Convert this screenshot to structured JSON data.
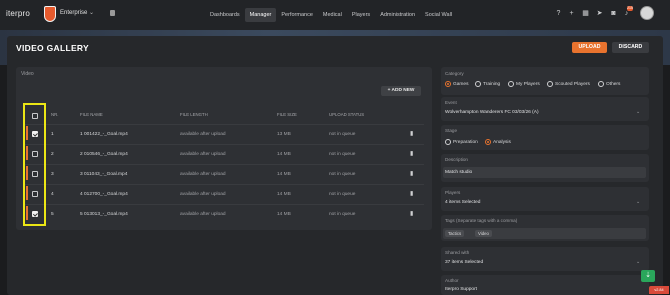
{
  "app": {
    "logo": "iterpro",
    "org": "Enterprise"
  },
  "nav": [
    "Dashboards",
    "Manager",
    "Performance",
    "Medical",
    "Players",
    "Administration",
    "Social Wall"
  ],
  "nav_active": "Manager",
  "notifications": "215",
  "page": {
    "title": "VIDEO GALLERY",
    "upload": "UPLOAD",
    "discard": "DISCARD"
  },
  "video": {
    "label": "Video",
    "add": "+ ADD NEW",
    "columns": [
      "NR.",
      "FILE NAME",
      "FILE LENGTH",
      "FILE SIZE",
      "UPLOAD STATUS"
    ],
    "rows": [
      {
        "nr": "1",
        "name": "1 001422_-_Goal.mp4",
        "length": "available after upload",
        "size": "13 MB",
        "status": "not in queue"
      },
      {
        "nr": "2",
        "name": "2 010546_-_Goal.mp4",
        "length": "available after upload",
        "size": "14 MB",
        "status": "not in queue"
      },
      {
        "nr": "3",
        "name": "3 011043_-_Goal.mp4",
        "length": "available after upload",
        "size": "14 MB",
        "status": "not in queue"
      },
      {
        "nr": "4",
        "name": "4 012700_-_Goal.mp4",
        "length": "available after upload",
        "size": "14 MB",
        "status": "not in queue"
      },
      {
        "nr": "5",
        "name": "5 013013_-_Goal.mp4",
        "length": "available after upload",
        "size": "14 MB",
        "status": "not in queue"
      }
    ]
  },
  "form": {
    "category_label": "Category",
    "categories": [
      "Games",
      "Training",
      "My Players",
      "Scouted Players",
      "Others"
    ],
    "category_selected": "Games",
    "event_label": "Event",
    "event_value": "Wolverhampton Wanderers FC 03/03/26 (A)",
    "stage_label": "Stage",
    "stages": [
      "Preparation",
      "Analysis"
    ],
    "stage_selected": "Analysis",
    "description_label": "Description",
    "description_value": "Match studio",
    "players_label": "Players",
    "players_value": "4 items Selected",
    "tags_label": "Tags (Separate tags with a comma)",
    "tags": [
      "Tactics",
      "Video"
    ],
    "shared_label": "Shared with",
    "shared_value": "37 items Selected",
    "author_label": "Author",
    "author_value": "Iterpro Support"
  },
  "version": "v2.84",
  "colors": {
    "accent": "#e8732e",
    "highlight": "#ece615",
    "fab": "#2aa65b"
  }
}
